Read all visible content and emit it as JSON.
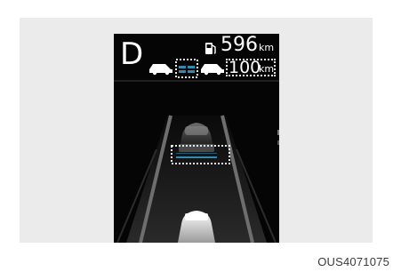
{
  "display": {
    "gear": "D",
    "range_value": "596",
    "range_unit": "km",
    "set_speed_value": "100",
    "set_speed_unit": "km/h"
  },
  "icons": {
    "fuel": "fuel-pump-icon",
    "lead_vehicle": "car-icon",
    "following_distance": "distance-bars-icon",
    "own_vehicle": "car-icon"
  },
  "colors": {
    "accent": "#2f8bb3",
    "display_background": "#050505",
    "highlight_border": "#e8e8e8"
  },
  "caption": "OUS4071075"
}
